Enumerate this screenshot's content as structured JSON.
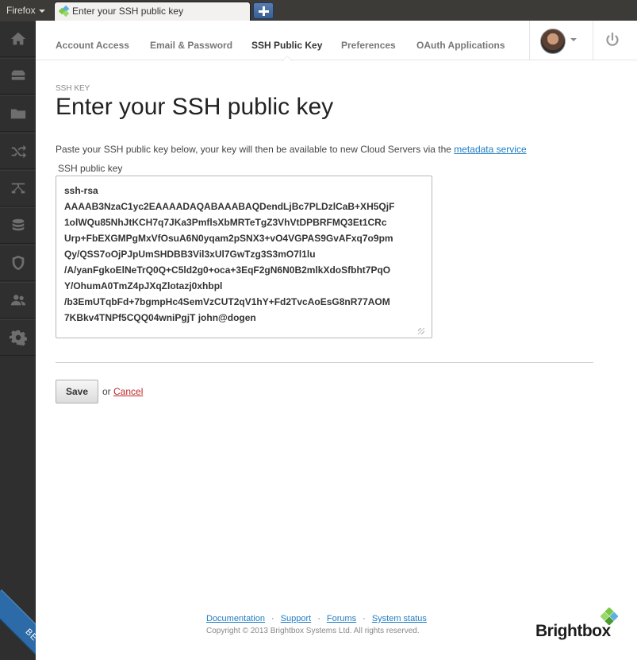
{
  "browser": {
    "menu_label": "Firefox",
    "tab_title": "Enter your SSH public key"
  },
  "sidebar": {
    "items": [
      {
        "icon": "home-icon"
      },
      {
        "icon": "server-icon"
      },
      {
        "icon": "folder-icon"
      },
      {
        "icon": "shuffle-icon"
      },
      {
        "icon": "load-balancer-icon"
      },
      {
        "icon": "database-icon"
      },
      {
        "icon": "shield-icon"
      },
      {
        "icon": "users-icon"
      },
      {
        "icon": "gear-icon"
      }
    ],
    "beta_label": "BETA"
  },
  "nav": {
    "tabs": [
      {
        "label": "Account Access"
      },
      {
        "label": "Email & Password"
      },
      {
        "label": "SSH Public Key"
      },
      {
        "label": "Preferences"
      },
      {
        "label": "OAuth Applications"
      }
    ],
    "active_tab": "SSH Public Key"
  },
  "main": {
    "section_label": "SSH KEY",
    "title": "Enter your SSH public key",
    "intro_text": "Paste your SSH public key below, your key will then be available to new Cloud Servers via the ",
    "intro_link": "metadata service",
    "field_label": "SSH public key",
    "ssh_key_value": "ssh-rsa\nAAAAB3NzaC1yc2EAAAADAQABAAABAQDendLjBc7PLDzlCaB+XH5QjF\n1olWQu85NhJtKCH7q7JKa3PmflsXbMRTeTgZ3VhVtDPBRFMQ3Et1CRc\nUrp+FbEXGMPgMxVfOsuA6N0yqam2pSNX3+vO4VGPAS9GvAFxq7o9pm\nQy/QSS7oOjPJpUmSHDBB3Vil3xUl7GwTzg3S3mO7l1lu\n/A/yanFgkoElNeTrQ0Q+C5ld2g0+oca+3EqF2gN6N0B2mlkXdoSfbht7PqO\nY/OhumA0TmZ4pJXqZlotazj0xhbpl\n/b3EmUTqbFd+7bgmpHc4SemVzCUT2qV1hY+Fd2TvcAoEsG8nR77AOM\n7KBkv4TNPf5CQQ04wniPgjT john@dogen",
    "save_label": "Save",
    "or_text": "or",
    "cancel_label": "Cancel"
  },
  "footer": {
    "links": [
      "Documentation",
      "Support",
      "Forums",
      "System status"
    ],
    "separator": "·",
    "copyright": "Copyright © 2013 Brightbox Systems Ltd. All rights reserved.",
    "logo_text": "Brightbox"
  },
  "colors": {
    "sidebar_bg": "#2f2f2f",
    "link": "#1d7cc3",
    "cancel": "#c0292c",
    "beta_ribbon": "#2c6aa8",
    "logo_green": "#7ac943"
  }
}
